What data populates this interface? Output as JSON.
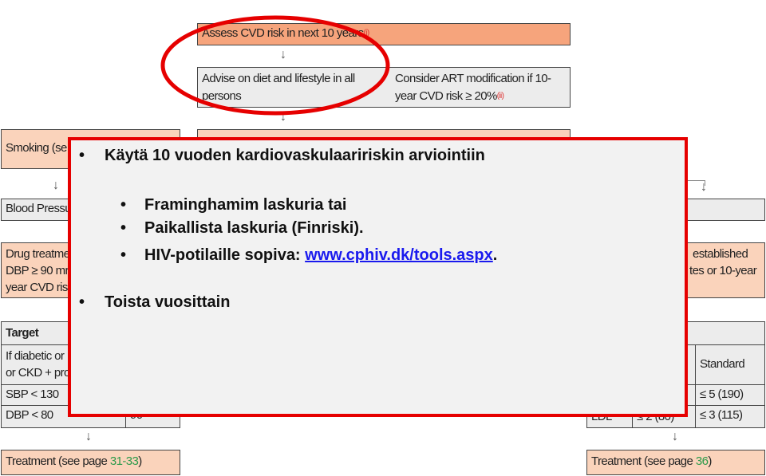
{
  "flow": {
    "assess": "Assess CVD risk in next 10 years",
    "assess_sup": "(i)",
    "advise": "Advise on diet and lifestyle in all persons",
    "consider": "Consider ART modification if 10-year CVD risk ≥ 20%",
    "consider_sup": "(ii)",
    "arrow": "↓"
  },
  "left": {
    "smoking": "Smoking  (se",
    "bp": "Blood Pressu",
    "drug": [
      "Drug treatme",
      "DBP ≥ 90 mr",
      "year CVD ris"
    ],
    "target_header": "Target",
    "row1": [
      "If diabetic or",
      "or CKD + pro"
    ],
    "row2": "SBP < 130",
    "row3": "DBP < 80",
    "row3b": "90",
    "treatment": "Treatment (see page ",
    "treatment_page": "31-33",
    "treatment_end": ")"
  },
  "right": {
    "drug": [
      "established",
      "tes or 10-year"
    ],
    "standard": "Standard",
    "row2": "≤ 5 (190)",
    "row3a": "LDL",
    "row3b": "≤ 2 (80)",
    "row3c": "≤ 3 (115)",
    "treatment": "Treatment (see page ",
    "treatment_page": "36",
    "treatment_end": ")"
  },
  "overlay": {
    "bullet": "•",
    "item1": "Käytä 10 vuoden kardiovaskulaaririskin arviointiin",
    "sub1": "Framinghamim laskuria tai",
    "sub2": "Paikallista laskuria (Finriski).",
    "sub3_text": "HIV-potilaille sopiva: ",
    "sub3_link": "www.cphiv.dk/tools.aspx",
    "sub3_end": ".",
    "item2": "Toista vuosittain"
  },
  "colors": {
    "highlight": "#e60000",
    "orange": "#f6a47c",
    "light_orange": "#fad3bb",
    "link": "#1a1aee"
  }
}
